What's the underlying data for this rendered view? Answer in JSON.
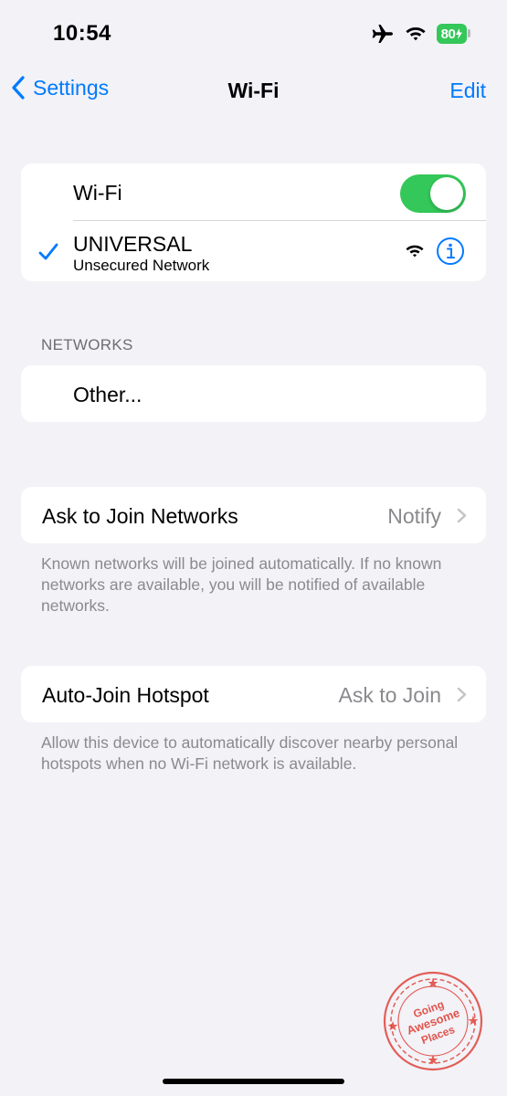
{
  "status_bar": {
    "time": "10:54",
    "battery": "80",
    "icons": [
      "airplane-icon",
      "wifi-icon",
      "battery-icon"
    ]
  },
  "nav": {
    "back_label": "Settings",
    "title": "Wi-Fi",
    "edit_label": "Edit"
  },
  "wifi_card": {
    "wifi_label": "Wi-Fi",
    "wifi_on": true,
    "connected_network": {
      "name": "UNIVERSAL",
      "security": "Unsecured Network"
    }
  },
  "networks_section": {
    "header": "NETWORKS",
    "other_label": "Other..."
  },
  "ask_to_join": {
    "label": "Ask to Join Networks",
    "value": "Notify",
    "footer": "Known networks will be joined automatically. If no known networks are available, you will be notified of available networks."
  },
  "auto_join": {
    "label": "Auto-Join Hotspot",
    "value": "Ask to Join",
    "footer": "Allow this device to automatically discover nearby personal hotspots when no Wi-Fi network is available."
  },
  "watermark": {
    "text": "Going Awesome Places",
    "color": "#e0443a"
  },
  "colors": {
    "accent": "#007aff",
    "toggle_on": "#34c759",
    "background": "#f2f2f7"
  }
}
